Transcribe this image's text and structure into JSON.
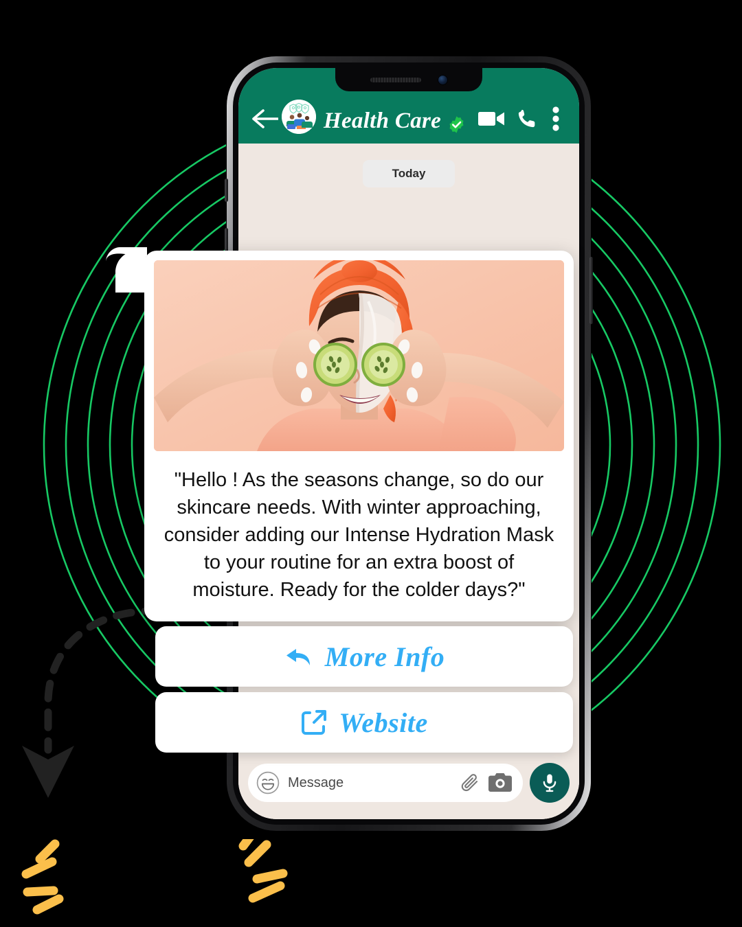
{
  "colors": {
    "header_green": "#087B5E",
    "chat_bg": "#EFE7E1",
    "accent_blue": "#33AEF5",
    "mic_teal": "#0A5C56",
    "verified_green": "#1FC44B",
    "ring_green": "#17C964",
    "sparkle_yellow": "#FBBF4B",
    "photo_bg_peach": "#F9C5AC"
  },
  "phone": {
    "notch": {
      "speaker": "speaker-grille",
      "camera": "front-camera"
    },
    "side_buttons": [
      "silent-switch",
      "volume-up",
      "volume-down",
      "power"
    ]
  },
  "header": {
    "back_icon": "back-arrow-icon",
    "avatar": "contact-avatar",
    "avatar_alt": "Health care workers illustration",
    "contact_name": "Health Care",
    "verified_icon": "verified-badge-icon",
    "actions": [
      {
        "name": "video-call",
        "icon": "video-camera-icon"
      },
      {
        "name": "voice-call",
        "icon": "phone-handset-icon"
      },
      {
        "name": "overflow-menu",
        "icon": "three-dots-vertical-icon"
      }
    ]
  },
  "chat": {
    "date_divider": "Today",
    "message": {
      "image_alt": "Woman with orange towel turban and white face mask holding cucumber slices over her eyes",
      "text": "\"Hello ! As the seasons change, so do our skincare needs. With winter approaching, consider adding our Intense Hydration Mask to your routine for an extra boost of moisture. Ready for the colder days?\""
    },
    "action_buttons": [
      {
        "label": "More Info",
        "icon": "reply-arrow-icon"
      },
      {
        "label": "Website",
        "icon": "external-link-icon"
      }
    ]
  },
  "input_bar": {
    "emoji_icon": "smiley-face-icon",
    "placeholder": "Message",
    "attach_icon": "paperclip-icon",
    "camera_icon": "camera-icon",
    "mic_icon": "microphone-icon"
  },
  "decorations": {
    "rings": "concentric-green-rings",
    "arrow": "dashed-curved-arrow",
    "sparkles": [
      "sparkle-burst-left",
      "sparkle-burst-right"
    ]
  }
}
